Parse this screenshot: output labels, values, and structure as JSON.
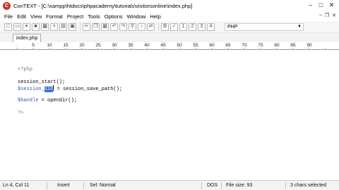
{
  "window": {
    "title": "ConTEXT - [C:\\xampp\\htdocs\\phpacademy\\tutorials\\visitorsonline\\index.php]",
    "app_icon": "context-app-icon",
    "controls": [
      "minimize",
      "maximize",
      "close"
    ]
  },
  "menu": {
    "items": [
      "File",
      "Edit",
      "View",
      "Format",
      "Project",
      "Tools",
      "Options",
      "Window",
      "Help"
    ]
  },
  "toolbar": {
    "buttons": [
      "new-file-icon",
      "open-file-icon",
      "reopen-icon",
      "save-icon",
      "save-all-icon",
      "close-file-icon",
      "print-icon",
      "print-preview-icon",
      "cut-icon",
      "copy-icon",
      "paste-icon",
      "undo-icon",
      "redo-icon",
      "find-icon",
      "find-next-icon",
      "replace-icon",
      "settings-icon",
      "spell-icon",
      "user-command-1-icon",
      "user-command-2-icon",
      "user-command-3-icon",
      "user-command-4-icon"
    ],
    "language": "PHP"
  },
  "tabs": [
    {
      "label": "index.php",
      "active": true
    }
  ],
  "ruler": {
    "labels": [
      ".",
      "5",
      "10",
      "15",
      "20",
      "25",
      "30",
      "35",
      "40",
      "45",
      "50",
      "55",
      "60",
      "65",
      "70",
      "75",
      "80",
      "85",
      "90"
    ]
  },
  "editor": {
    "lines": [
      {
        "parts": [
          {
            "t": "<?php",
            "c": "php-tag"
          }
        ]
      },
      {
        "parts": []
      },
      {
        "parts": [
          {
            "t": "session_start();",
            "c": ""
          }
        ]
      },
      {
        "parts": [
          {
            "t": "$session_",
            "c": "var"
          },
          {
            "t": "sid",
            "c": "sel"
          },
          {
            "t": " = session_save_path();",
            "c": ""
          }
        ]
      },
      {
        "parts": []
      },
      {
        "parts": [
          {
            "t": "$handle",
            "c": "var"
          },
          {
            "t": " = opendir();",
            "c": ""
          }
        ]
      },
      {
        "parts": []
      },
      {
        "parts": [
          {
            "t": "?>",
            "c": "php-tag"
          }
        ]
      }
    ]
  },
  "status": {
    "position": "Ln 4, Col 11",
    "mode": "Insert",
    "sel_mode": "Sel: Normal",
    "format": "DOS",
    "file_size": "File size: 93",
    "selection": "3 chars selected"
  },
  "colors": {
    "selection": "#2f6fd0",
    "variable": "#2a5db0",
    "php_tag": "#7c7c7c",
    "app_icon": "#c8322a"
  }
}
